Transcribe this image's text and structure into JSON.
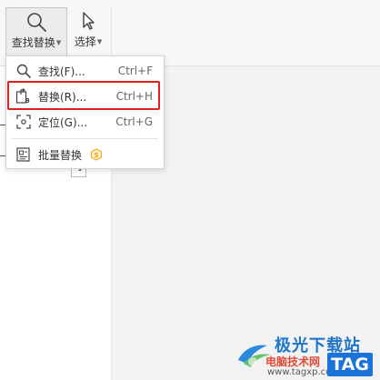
{
  "ribbon": {
    "find_replace_label": "查找替换",
    "select_label": "选择"
  },
  "menu": {
    "items": [
      {
        "label": "查找(F)...",
        "shortcut": "Ctrl+F",
        "icon": "search-icon"
      },
      {
        "label": "替换(R)...",
        "shortcut": "Ctrl+H",
        "icon": "replace-icon"
      },
      {
        "label": "定位(G)...",
        "shortcut": "Ctrl+G",
        "icon": "locate-icon"
      },
      {
        "label": "批量替换",
        "shortcut": "",
        "icon": "batch-replace-icon",
        "badge_icon": "premium-badge-icon"
      }
    ]
  },
  "watermark": {
    "site_name": "极光下载站",
    "site_name_2": "电脑技术网",
    "url": "www.tagxp.com",
    "tag": "TAG"
  },
  "colors": {
    "highlight": "#e0201c",
    "watermark_blue": "#1a73d9",
    "premium_badge": "#f0a81c"
  }
}
